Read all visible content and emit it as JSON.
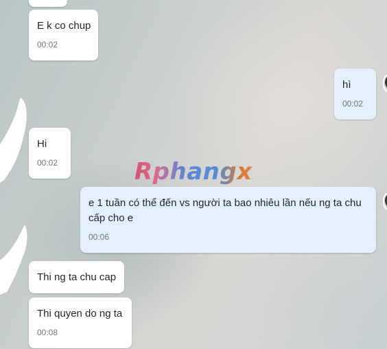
{
  "messages": [
    {
      "id": "m0",
      "direction": "in",
      "text": "",
      "time": ""
    },
    {
      "id": "m1",
      "direction": "in",
      "text": "E k co chup",
      "time": "00:02"
    },
    {
      "id": "m2",
      "direction": "out",
      "text": "hì",
      "time": "00:02"
    },
    {
      "id": "m3",
      "direction": "in",
      "text": "Hi",
      "time": "00:02"
    },
    {
      "id": "m4",
      "direction": "out",
      "text": "e 1 tuần có thể đến vs người ta bao nhiêu lần nếu ng ta chu cấp cho e",
      "time": "00:06"
    },
    {
      "id": "m5",
      "direction": "in",
      "text": "Thi ng ta chu cap",
      "time": ""
    },
    {
      "id": "m6",
      "direction": "in",
      "text": "Thi quyen do ng ta",
      "time": "00:08"
    }
  ],
  "watermark": "Rphangx",
  "colors": {
    "incoming_bubble": "#ffffff",
    "outgoing_bubble": "#e5effd",
    "timestamp": "#6e7480",
    "text": "#1e2430"
  }
}
